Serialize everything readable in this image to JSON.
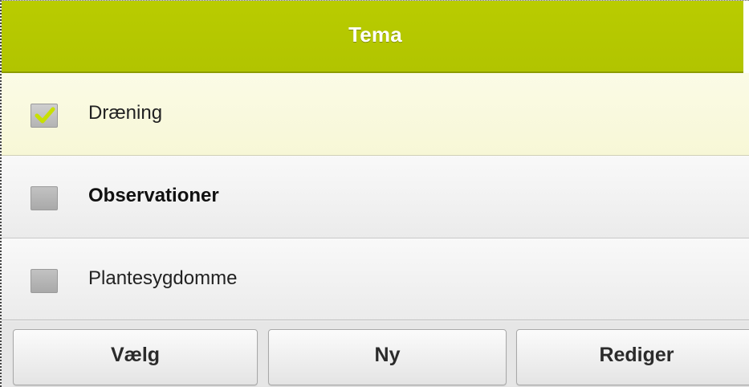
{
  "header": {
    "title": "Tema",
    "color": "#b5c800"
  },
  "items": [
    {
      "label": "Dræning",
      "checked": true,
      "selected": true,
      "bold": false
    },
    {
      "label": "Observationer",
      "checked": false,
      "selected": false,
      "bold": true
    },
    {
      "label": "Plantesygdomme",
      "checked": false,
      "selected": false,
      "bold": false
    }
  ],
  "toolbar": {
    "buttons": [
      {
        "label": "Vælg"
      },
      {
        "label": "Ny"
      },
      {
        "label": "Rediger"
      }
    ]
  },
  "colors": {
    "accent": "#b5c800",
    "check_mark": "#c8e000",
    "selected_row": "#fafadf"
  }
}
